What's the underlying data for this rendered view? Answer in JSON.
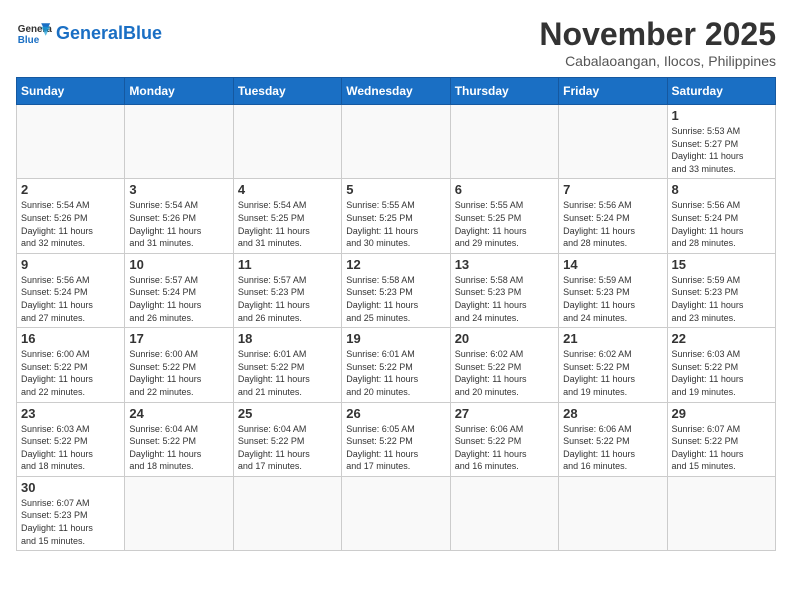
{
  "header": {
    "logo_general": "General",
    "logo_blue": "Blue",
    "month_title": "November 2025",
    "location": "Cabalaoangan, Ilocos, Philippines"
  },
  "days_of_week": [
    "Sunday",
    "Monday",
    "Tuesday",
    "Wednesday",
    "Thursday",
    "Friday",
    "Saturday"
  ],
  "weeks": [
    [
      {
        "day": "",
        "info": ""
      },
      {
        "day": "",
        "info": ""
      },
      {
        "day": "",
        "info": ""
      },
      {
        "day": "",
        "info": ""
      },
      {
        "day": "",
        "info": ""
      },
      {
        "day": "",
        "info": ""
      },
      {
        "day": "1",
        "info": "Sunrise: 5:53 AM\nSunset: 5:27 PM\nDaylight: 11 hours\nand 33 minutes."
      }
    ],
    [
      {
        "day": "2",
        "info": "Sunrise: 5:54 AM\nSunset: 5:26 PM\nDaylight: 11 hours\nand 32 minutes."
      },
      {
        "day": "3",
        "info": "Sunrise: 5:54 AM\nSunset: 5:26 PM\nDaylight: 11 hours\nand 31 minutes."
      },
      {
        "day": "4",
        "info": "Sunrise: 5:54 AM\nSunset: 5:25 PM\nDaylight: 11 hours\nand 31 minutes."
      },
      {
        "day": "5",
        "info": "Sunrise: 5:55 AM\nSunset: 5:25 PM\nDaylight: 11 hours\nand 30 minutes."
      },
      {
        "day": "6",
        "info": "Sunrise: 5:55 AM\nSunset: 5:25 PM\nDaylight: 11 hours\nand 29 minutes."
      },
      {
        "day": "7",
        "info": "Sunrise: 5:56 AM\nSunset: 5:24 PM\nDaylight: 11 hours\nand 28 minutes."
      },
      {
        "day": "8",
        "info": "Sunrise: 5:56 AM\nSunset: 5:24 PM\nDaylight: 11 hours\nand 28 minutes."
      }
    ],
    [
      {
        "day": "9",
        "info": "Sunrise: 5:56 AM\nSunset: 5:24 PM\nDaylight: 11 hours\nand 27 minutes."
      },
      {
        "day": "10",
        "info": "Sunrise: 5:57 AM\nSunset: 5:24 PM\nDaylight: 11 hours\nand 26 minutes."
      },
      {
        "day": "11",
        "info": "Sunrise: 5:57 AM\nSunset: 5:23 PM\nDaylight: 11 hours\nand 26 minutes."
      },
      {
        "day": "12",
        "info": "Sunrise: 5:58 AM\nSunset: 5:23 PM\nDaylight: 11 hours\nand 25 minutes."
      },
      {
        "day": "13",
        "info": "Sunrise: 5:58 AM\nSunset: 5:23 PM\nDaylight: 11 hours\nand 24 minutes."
      },
      {
        "day": "14",
        "info": "Sunrise: 5:59 AM\nSunset: 5:23 PM\nDaylight: 11 hours\nand 24 minutes."
      },
      {
        "day": "15",
        "info": "Sunrise: 5:59 AM\nSunset: 5:23 PM\nDaylight: 11 hours\nand 23 minutes."
      }
    ],
    [
      {
        "day": "16",
        "info": "Sunrise: 6:00 AM\nSunset: 5:22 PM\nDaylight: 11 hours\nand 22 minutes."
      },
      {
        "day": "17",
        "info": "Sunrise: 6:00 AM\nSunset: 5:22 PM\nDaylight: 11 hours\nand 22 minutes."
      },
      {
        "day": "18",
        "info": "Sunrise: 6:01 AM\nSunset: 5:22 PM\nDaylight: 11 hours\nand 21 minutes."
      },
      {
        "day": "19",
        "info": "Sunrise: 6:01 AM\nSunset: 5:22 PM\nDaylight: 11 hours\nand 20 minutes."
      },
      {
        "day": "20",
        "info": "Sunrise: 6:02 AM\nSunset: 5:22 PM\nDaylight: 11 hours\nand 20 minutes."
      },
      {
        "day": "21",
        "info": "Sunrise: 6:02 AM\nSunset: 5:22 PM\nDaylight: 11 hours\nand 19 minutes."
      },
      {
        "day": "22",
        "info": "Sunrise: 6:03 AM\nSunset: 5:22 PM\nDaylight: 11 hours\nand 19 minutes."
      }
    ],
    [
      {
        "day": "23",
        "info": "Sunrise: 6:03 AM\nSunset: 5:22 PM\nDaylight: 11 hours\nand 18 minutes."
      },
      {
        "day": "24",
        "info": "Sunrise: 6:04 AM\nSunset: 5:22 PM\nDaylight: 11 hours\nand 18 minutes."
      },
      {
        "day": "25",
        "info": "Sunrise: 6:04 AM\nSunset: 5:22 PM\nDaylight: 11 hours\nand 17 minutes."
      },
      {
        "day": "26",
        "info": "Sunrise: 6:05 AM\nSunset: 5:22 PM\nDaylight: 11 hours\nand 17 minutes."
      },
      {
        "day": "27",
        "info": "Sunrise: 6:06 AM\nSunset: 5:22 PM\nDaylight: 11 hours\nand 16 minutes."
      },
      {
        "day": "28",
        "info": "Sunrise: 6:06 AM\nSunset: 5:22 PM\nDaylight: 11 hours\nand 16 minutes."
      },
      {
        "day": "29",
        "info": "Sunrise: 6:07 AM\nSunset: 5:22 PM\nDaylight: 11 hours\nand 15 minutes."
      }
    ],
    [
      {
        "day": "30",
        "info": "Sunrise: 6:07 AM\nSunset: 5:23 PM\nDaylight: 11 hours\nand 15 minutes."
      },
      {
        "day": "",
        "info": ""
      },
      {
        "day": "",
        "info": ""
      },
      {
        "day": "",
        "info": ""
      },
      {
        "day": "",
        "info": ""
      },
      {
        "day": "",
        "info": ""
      },
      {
        "day": "",
        "info": ""
      }
    ]
  ]
}
